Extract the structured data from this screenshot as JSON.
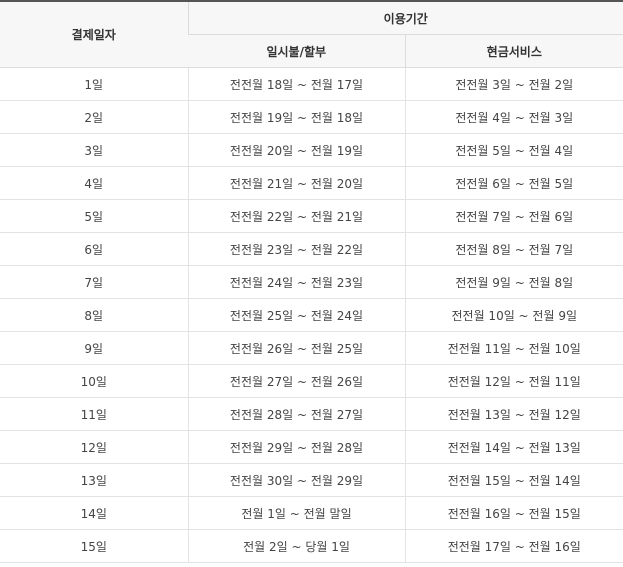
{
  "table": {
    "header": {
      "payment_day": "결제일자",
      "usage_period": "이용기간",
      "installment": "일시불/할부",
      "cash_service": "현금서비스"
    },
    "rows": [
      {
        "day": "1일",
        "installment": "전전월 18일 ~ 전월 17일",
        "cash": "전전월 3일 ~ 전월 2일"
      },
      {
        "day": "2일",
        "installment": "전전월 19일 ~ 전월 18일",
        "cash": "전전월 4일 ~ 전월 3일"
      },
      {
        "day": "3일",
        "installment": "전전월 20일 ~ 전월 19일",
        "cash": "전전월 5일 ~ 전월 4일"
      },
      {
        "day": "4일",
        "installment": "전전월 21일 ~ 전월 20일",
        "cash": "전전월 6일 ~ 전월 5일"
      },
      {
        "day": "5일",
        "installment": "전전월 22일 ~ 전월 21일",
        "cash": "전전월 7일 ~ 전월 6일"
      },
      {
        "day": "6일",
        "installment": "전전월 23일 ~ 전월 22일",
        "cash": "전전월 8일 ~ 전월 7일"
      },
      {
        "day": "7일",
        "installment": "전전월 24일 ~ 전월 23일",
        "cash": "전전월 9일 ~ 전월 8일"
      },
      {
        "day": "8일",
        "installment": "전전월 25일 ~ 전월 24일",
        "cash": "전전월 10일 ~ 전월 9일"
      },
      {
        "day": "9일",
        "installment": "전전월 26일 ~ 전월 25일",
        "cash": "전전월 11일 ~ 전월 10일"
      },
      {
        "day": "10일",
        "installment": "전전월 27일 ~ 전월 26일",
        "cash": "전전월 12일 ~ 전월 11일"
      },
      {
        "day": "11일",
        "installment": "전전월 28일 ~ 전월 27일",
        "cash": "전전월 13일 ~ 전월 12일"
      },
      {
        "day": "12일",
        "installment": "전전월 29일 ~ 전월 28일",
        "cash": "전전월 14일 ~ 전월 13일"
      },
      {
        "day": "13일",
        "installment": "전전월 30일 ~ 전월 29일",
        "cash": "전전월 15일 ~ 전월 14일"
      },
      {
        "day": "14일",
        "installment": "전월 1일 ~ 전월 말일",
        "cash": "전전월 16일 ~ 전월 15일"
      },
      {
        "day": "15일",
        "installment": "전월 2일 ~ 당월 1일",
        "cash": "전전월 17일 ~ 전월 16일"
      }
    ]
  },
  "colors": {
    "header_bg": "#f7f7f7",
    "top_border": "#555555",
    "grid_line": "#e3e3e3",
    "text": "#444444"
  }
}
